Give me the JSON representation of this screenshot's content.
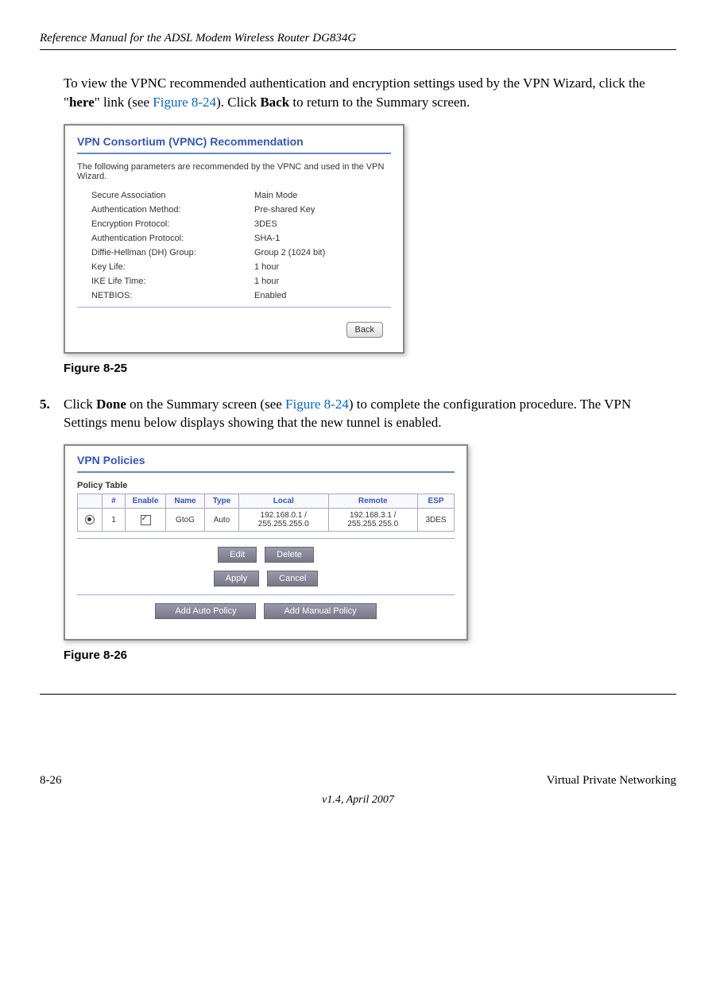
{
  "header": {
    "title": "Reference Manual for the ADSL Modem Wireless Router DG834G"
  },
  "para1": {
    "prefix": "To view the VPNC recommended authentication and encryption settings used by the VPN Wizard, click the \"",
    "here": "here",
    "mid": "\" link (see ",
    "figref": "Figure 8-24",
    "after": "). Click ",
    "back": "Back",
    "end": " to return to the Summary screen."
  },
  "screenshot1": {
    "title": "VPN Consortium (VPNC) Recommendation",
    "desc": "The following parameters are recommended by the VPNC and used in the VPN Wizard.",
    "rows": [
      {
        "label": "Secure Association",
        "value": "Main Mode"
      },
      {
        "label": "Authentication Method:",
        "value": "Pre-shared Key"
      },
      {
        "label": "Encryption Protocol:",
        "value": "3DES"
      },
      {
        "label": "Authentication Protocol:",
        "value": "SHA-1"
      },
      {
        "label": "Diffie-Hellman (DH) Group:",
        "value": "Group 2 (1024 bit)"
      },
      {
        "label": "Key Life:",
        "value": "1 hour"
      },
      {
        "label": "IKE Life Time:",
        "value": "1 hour"
      },
      {
        "label": "NETBIOS:",
        "value": "Enabled"
      }
    ],
    "back_btn": "Back"
  },
  "fig1_label": "Figure 8-25",
  "step5": {
    "num": "5.",
    "prefix": "Click ",
    "done": "Done",
    "mid": " on the Summary screen (see ",
    "figref": "Figure 8-24",
    "end": ") to complete the configuration procedure. The VPN Settings menu below displays showing that the new tunnel is enabled."
  },
  "screenshot2": {
    "title": "VPN Policies",
    "table_label": "Policy Table",
    "headers": {
      "col1": "",
      "num": "#",
      "enable": "Enable",
      "name": "Name",
      "type": "Type",
      "local": "Local",
      "remote": "Remote",
      "esp": "ESP"
    },
    "row": {
      "num": "1",
      "name": "GtoG",
      "type": "Auto",
      "local": "192.168.0.1 / 255.255.255.0",
      "remote": "192.168.3.1 / 255.255.255.0",
      "esp": "3DES"
    },
    "buttons": {
      "edit": "Edit",
      "delete": "Delete",
      "apply": "Apply",
      "cancel": "Cancel",
      "add_auto": "Add Auto Policy",
      "add_manual": "Add Manual Policy"
    }
  },
  "fig2_label": "Figure 8-26",
  "footer": {
    "page": "8-26",
    "section": "Virtual Private Networking",
    "version": "v1.4, April 2007"
  }
}
